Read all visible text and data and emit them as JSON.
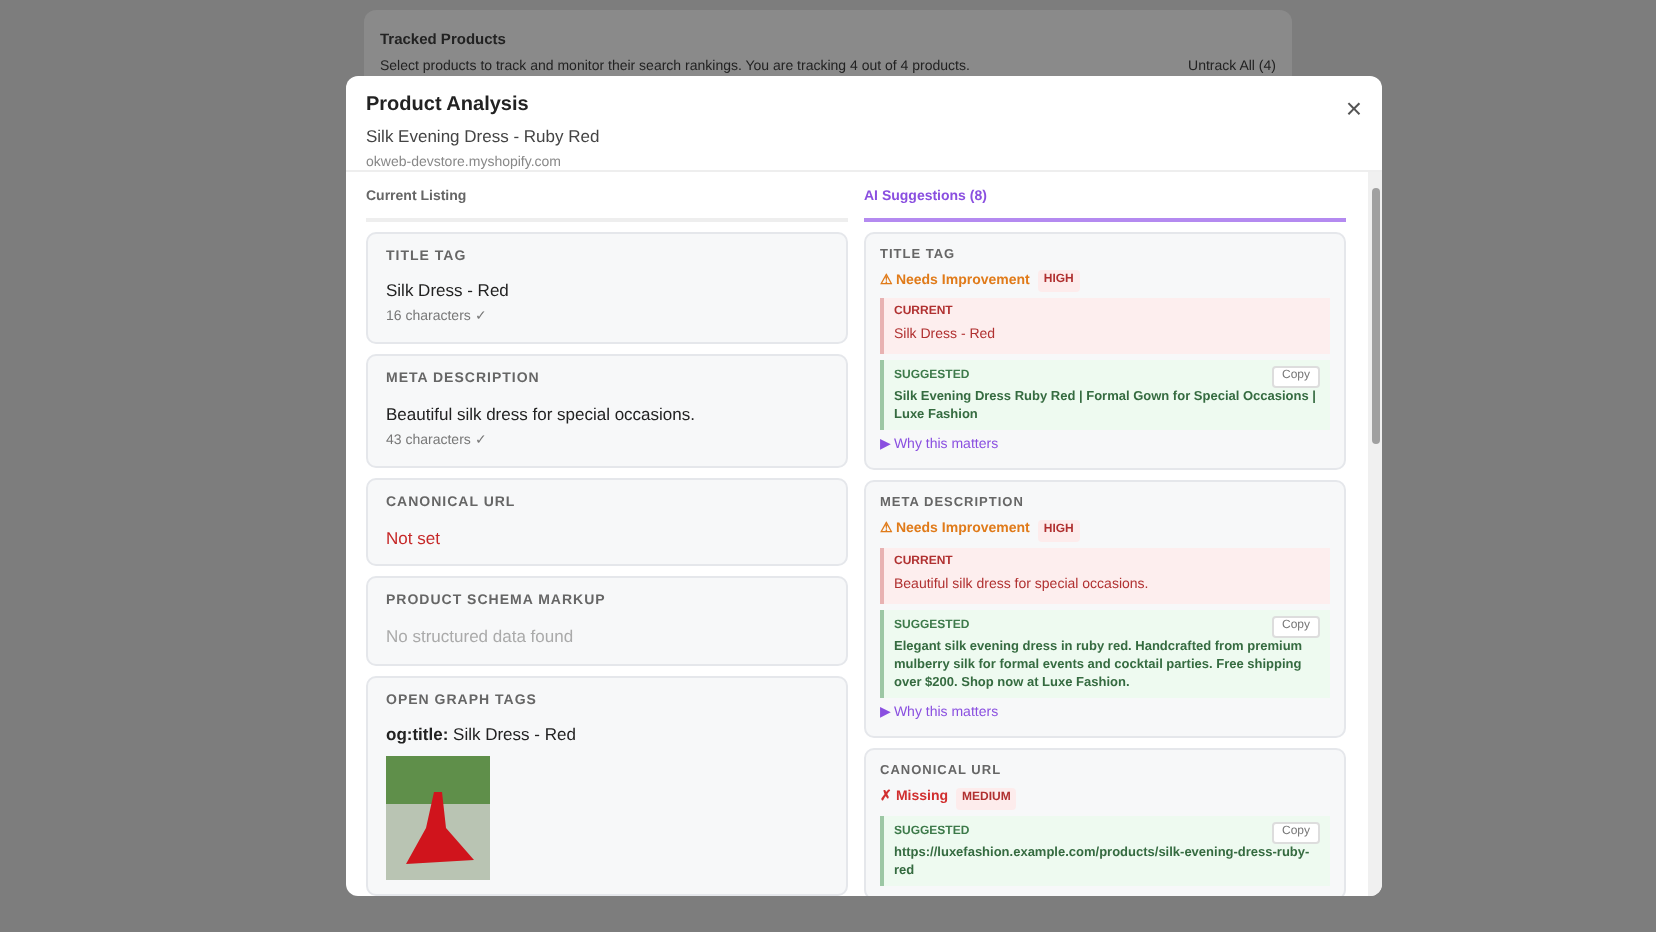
{
  "background": {
    "title": "Tracked Products",
    "description": "Select products to track and monitor their search rankings. You are tracking 4 out of 4 products.",
    "untrack_button": "Untrack All (4)"
  },
  "modal": {
    "title": "Product Analysis",
    "product": "Silk Evening Dress - Ruby Red",
    "store": "okweb-devstore.myshopify.com",
    "close": "×"
  },
  "current_listing": {
    "heading": "Current Listing",
    "sections": [
      {
        "kind": "value",
        "label": "TITLE TAG",
        "value": "Silk Dress - Red",
        "note": "16 characters ✓"
      },
      {
        "kind": "value",
        "label": "META DESCRIPTION",
        "value": "Beautiful silk dress for special occasions.",
        "note": "43 characters ✓"
      },
      {
        "kind": "error",
        "label": "CANONICAL URL",
        "value": "Not set"
      },
      {
        "kind": "empty",
        "label": "PRODUCT SCHEMA MARKUP",
        "value": "No structured data found"
      },
      {
        "kind": "og",
        "label": "OPEN GRAPH TAGS",
        "value": "**og:title:** Silk Dress - Red"
      }
    ]
  },
  "suggestions": {
    "heading": "AI Suggestions (8)",
    "items": [
      {
        "label": "TITLE TAG",
        "kind": "warning",
        "status": "⚠ Needs Improvement",
        "priority": "HIGH",
        "current_label": "CURRENT",
        "current": "Silk Dress - Red",
        "suggested_label": "SUGGESTED",
        "suggested": "Silk Evening Dress Ruby Red | Formal Gown for Special Occasions | Luxe Fashion",
        "copy": "Copy",
        "why": "▶ Why this matters"
      },
      {
        "label": "META DESCRIPTION",
        "kind": "warning",
        "status": "⚠ Needs Improvement",
        "priority": "HIGH",
        "current_label": "CURRENT",
        "current": "Beautiful silk dress for special occasions.",
        "suggested_label": "SUGGESTED",
        "suggested": "Elegant silk evening dress in ruby red. Handcrafted from premium mulberry silk for formal events and cocktail parties. Free shipping over $200. Shop now at Luxe Fashion.",
        "copy": "Copy",
        "why": "▶ Why this matters"
      },
      {
        "label": "CANONICAL URL",
        "kind": "missing",
        "status": "✗ Missing",
        "priority": "MEDIUM",
        "suggested_label": "SUGGESTED",
        "suggested": "https://luxefashion.example.com/products/silk-evening-dress-ruby-red",
        "copy": "Copy"
      }
    ]
  }
}
